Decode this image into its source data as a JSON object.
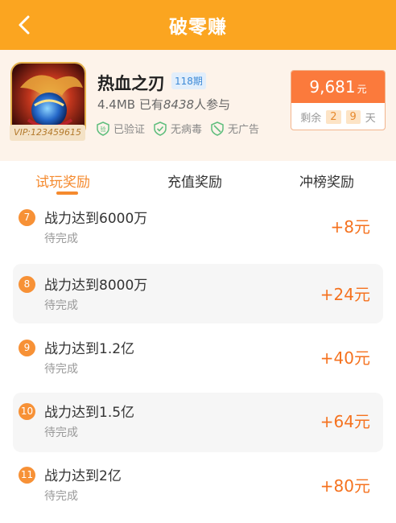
{
  "nav": {
    "title": "破零赚"
  },
  "app": {
    "name": "热血之刃",
    "issue": "118期",
    "size": "4.4MB",
    "participants_prefix": "已有",
    "participants_count": "8438",
    "participants_suffix": "人参与",
    "vip": "VIP:123459615",
    "badges": [
      {
        "label": "已验证",
        "icon": "verified-icon"
      },
      {
        "label": "无病毒",
        "icon": "shield-check-icon"
      },
      {
        "label": "无广告",
        "icon": "no-ads-shield-icon"
      }
    ]
  },
  "reward_box": {
    "amount": "9,681",
    "unit": "元",
    "remain_label": "剩余",
    "days_digit1": "2",
    "days_digit2": "9",
    "days_unit": "天"
  },
  "tabs": [
    {
      "label": "试玩奖励",
      "active": true
    },
    {
      "label": "充值奖励",
      "active": false
    },
    {
      "label": "冲榜奖励",
      "active": false
    }
  ],
  "tasks": [
    {
      "num": "7",
      "name": "战力达到6000万",
      "status": "待完成",
      "reward": "+8元"
    },
    {
      "num": "8",
      "name": "战力达到8000万",
      "status": "待完成",
      "reward": "+24元"
    },
    {
      "num": "9",
      "name": "战力达到1.2亿",
      "status": "待完成",
      "reward": "+40元"
    },
    {
      "num": "10",
      "name": "战力达到1.5亿",
      "status": "待完成",
      "reward": "+64元"
    },
    {
      "num": "11",
      "name": "战力达到2亿",
      "status": "待完成",
      "reward": "+80元"
    }
  ],
  "colors": {
    "brand": "#fba520",
    "accent": "#f58a2e",
    "reward": "#f5721f",
    "badge_green": "#5fbe7d"
  }
}
